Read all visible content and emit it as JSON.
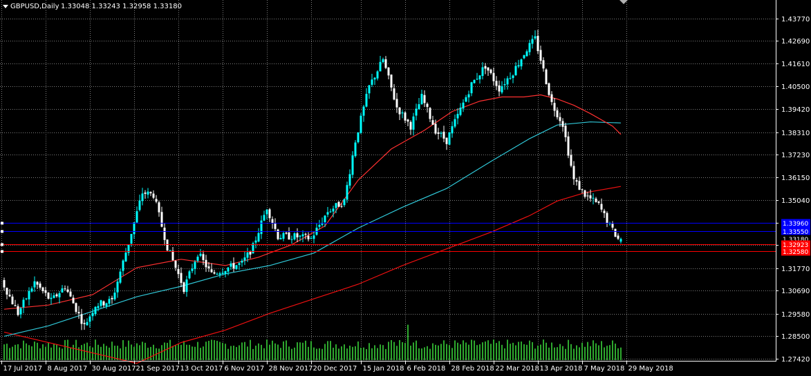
{
  "header": {
    "symbol": "GBPUSD,Daily",
    "ohlc": "1.33048 1.33243 1.32958 1.33180"
  },
  "colors": {
    "background": "#000000",
    "grid": "#7f7f7f",
    "bull_candle": "#00ffff",
    "bear_candle": "#ffffff",
    "ma_fast": "#ff3030",
    "ma_mid": "#30c8d8",
    "ma_slow": "#ee1010",
    "blue_levels": "#0000ff",
    "red_levels": "#ff0000",
    "volume": "#2ea82e"
  },
  "chart_data": {
    "type": "candlestick",
    "ylim": [
      1.2742,
      1.4436
    ],
    "y_ticks": [
      "1.43770",
      "1.42690",
      "1.41610",
      "1.40500",
      "1.39420",
      "1.38310",
      "1.37230",
      "1.36150",
      "1.35040",
      "1.33960",
      "1.32880",
      "1.31770",
      "1.30690",
      "1.29580",
      "1.28500",
      "1.27420"
    ],
    "x_ticks": [
      "17 Jul 2017",
      "8 Aug 2017",
      "30 Aug 2017",
      "21 Sep 2017",
      "13 Oct 2017",
      "6 Nov 2017",
      "28 Nov 2017",
      "20 Dec 2017",
      "15 Jan 2018",
      "6 Feb 2018",
      "28 Feb 2018",
      "22 Mar 2018",
      "13 Apr 2018",
      "7 May 2018",
      "29 May 2018"
    ],
    "x_tick_index": [
      0,
      16,
      32,
      48,
      64,
      80,
      96,
      112,
      130,
      146,
      162,
      178,
      194,
      210,
      226
    ],
    "total_bars": 224,
    "anchors": [
      [
        0,
        1.312
      ],
      [
        6,
        1.296
      ],
      [
        12,
        1.311
      ],
      [
        18,
        1.302
      ],
      [
        23,
        1.309
      ],
      [
        30,
        1.29
      ],
      [
        34,
        1.3
      ],
      [
        40,
        1.3022
      ],
      [
        46,
        1.33
      ],
      [
        51,
        1.354
      ],
      [
        55,
        1.353
      ],
      [
        60,
        1.328
      ],
      [
        66,
        1.308
      ],
      [
        71,
        1.325
      ],
      [
        76,
        1.3148
      ],
      [
        82,
        1.318
      ],
      [
        87,
        1.32
      ],
      [
        91,
        1.328
      ],
      [
        96,
        1.347
      ],
      [
        100,
        1.333
      ],
      [
        106,
        1.333
      ],
      [
        112,
        1.332
      ],
      [
        118,
        1.345
      ],
      [
        124,
        1.35
      ],
      [
        128,
        1.379
      ],
      [
        133,
        1.405
      ],
      [
        138,
        1.418
      ],
      [
        143,
        1.395
      ],
      [
        148,
        1.386
      ],
      [
        152,
        1.4
      ],
      [
        157,
        1.384
      ],
      [
        161,
        1.379
      ],
      [
        166,
        1.394
      ],
      [
        170,
        1.406
      ],
      [
        175,
        1.415
      ],
      [
        180,
        1.404
      ],
      [
        185,
        1.412
      ],
      [
        190,
        1.423
      ],
      [
        193,
        1.428
      ],
      [
        195,
        1.418
      ],
      [
        199,
        1.397
      ],
      [
        203,
        1.387
      ],
      [
        207,
        1.36
      ],
      [
        211,
        1.353
      ],
      [
        216,
        1.348
      ],
      [
        220,
        1.338
      ],
      [
        223,
        1.3318
      ]
    ],
    "last_candle": {
      "open": 1.33048,
      "high": 1.33243,
      "low": 1.32958,
      "close": 1.3318
    },
    "ma_fast_points": [
      [
        0,
        1.298
      ],
      [
        16,
        1.3
      ],
      [
        32,
        1.305
      ],
      [
        48,
        1.318
      ],
      [
        64,
        1.322
      ],
      [
        80,
        1.319
      ],
      [
        92,
        1.323
      ],
      [
        104,
        1.329
      ],
      [
        116,
        1.338
      ],
      [
        128,
        1.36
      ],
      [
        140,
        1.375
      ],
      [
        152,
        1.384
      ],
      [
        162,
        1.393
      ],
      [
        172,
        1.398
      ],
      [
        180,
        1.4
      ],
      [
        188,
        1.4
      ],
      [
        194,
        1.401
      ],
      [
        200,
        1.399
      ],
      [
        206,
        1.396
      ],
      [
        212,
        1.392
      ],
      [
        220,
        1.386
      ],
      [
        223,
        1.382
      ]
    ],
    "ma_mid_points": [
      [
        0,
        1.285
      ],
      [
        16,
        1.29
      ],
      [
        32,
        1.297
      ],
      [
        48,
        1.304
      ],
      [
        64,
        1.309
      ],
      [
        80,
        1.315
      ],
      [
        96,
        1.319
      ],
      [
        112,
        1.325
      ],
      [
        128,
        1.337
      ],
      [
        144,
        1.347
      ],
      [
        160,
        1.356
      ],
      [
        176,
        1.369
      ],
      [
        190,
        1.38
      ],
      [
        200,
        1.3865
      ],
      [
        212,
        1.388
      ],
      [
        223,
        1.3875
      ]
    ],
    "ma_slow_points": [
      [
        0,
        1.287
      ],
      [
        48,
        1.272
      ],
      [
        64,
        1.282
      ],
      [
        80,
        1.288
      ],
      [
        96,
        1.296
      ],
      [
        112,
        1.303
      ],
      [
        128,
        1.31
      ],
      [
        144,
        1.319
      ],
      [
        160,
        1.327
      ],
      [
        176,
        1.335
      ],
      [
        190,
        1.343
      ],
      [
        200,
        1.35
      ],
      [
        210,
        1.354
      ],
      [
        223,
        1.357
      ]
    ],
    "levels": [
      {
        "value": "1.33960",
        "price": 1.3396,
        "color": "blue"
      },
      {
        "value": "1.33550",
        "price": 1.3355,
        "color": "blue"
      },
      {
        "value": "1.33180",
        "price": 1.3318,
        "color": "current"
      },
      {
        "value": "1.32923",
        "price": 1.32923,
        "color": "red"
      },
      {
        "value": "1.32580",
        "price": 1.3258,
        "color": "red"
      }
    ],
    "volume_spikes": [
      [
        146,
        2.6
      ],
      [
        148,
        1.5
      ],
      [
        140,
        1.3
      ]
    ]
  }
}
